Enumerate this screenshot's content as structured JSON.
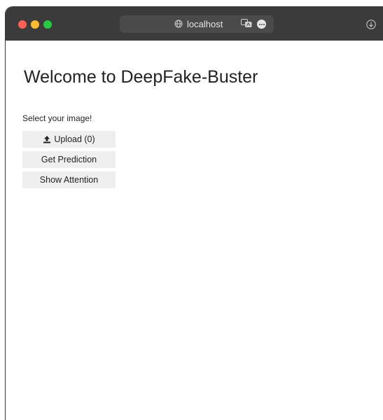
{
  "browser": {
    "address": "localhost"
  },
  "page": {
    "title": "Welcome to DeepFake-Buster",
    "prompt": "Select your image!",
    "buttons": {
      "upload_label": "Upload (0)",
      "predict_label": "Get Prediction",
      "attention_label": "Show Attention"
    }
  },
  "icons": {
    "globe": "globe-icon",
    "translate": "translate-icon",
    "more": "more-icon",
    "download": "download-icon",
    "upload": "upload-icon"
  },
  "colors": {
    "titlebar": "#3b3b3b",
    "address_bar": "#4a4a4a",
    "button_bg": "#efefef",
    "close": "#fe5f57",
    "minimize": "#febc2e",
    "maximize": "#28c840"
  }
}
